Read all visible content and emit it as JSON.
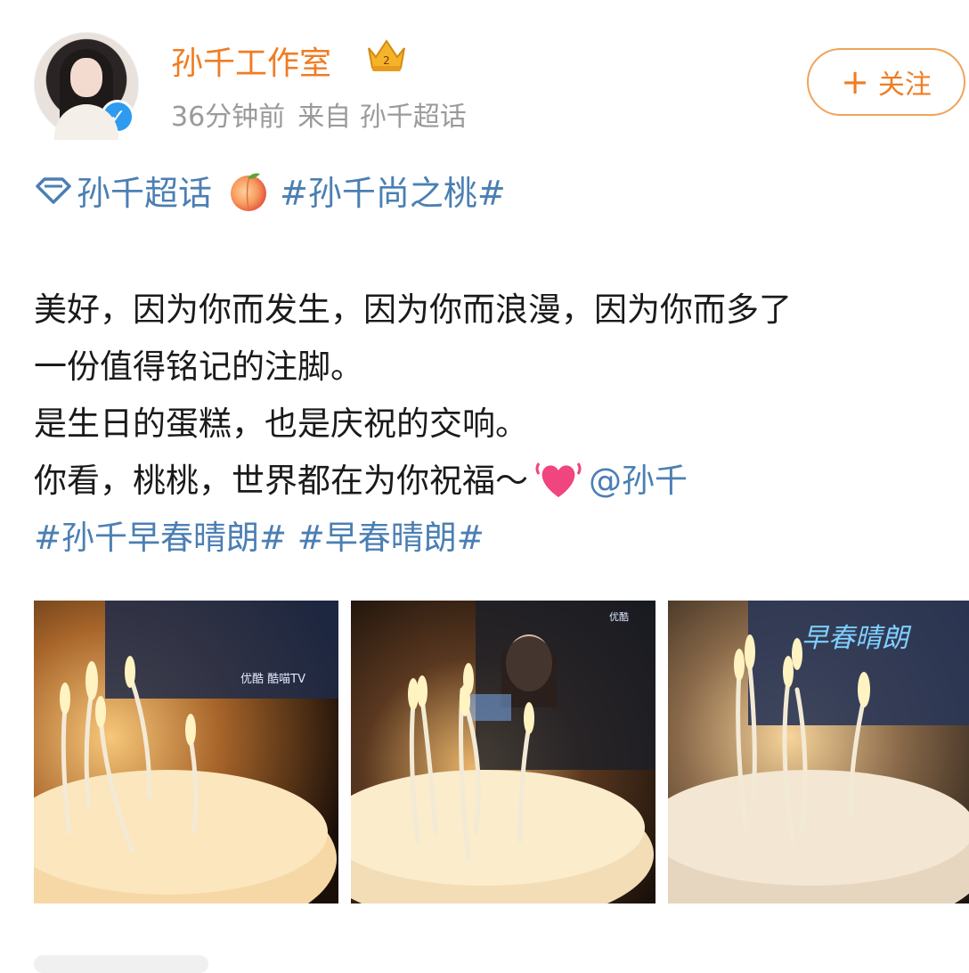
{
  "post": {
    "author_name": "孙千工作室",
    "time": "36分钟前",
    "source": "来自 孙千超话",
    "follow_label": "关注",
    "topic_super": "孙千超话",
    "topic_tag": "#孙千尚之桃#",
    "line1": "美好，因为你而发生，因为你而浪漫，因为你而多了",
    "line2": "一份值得铭记的注脚。",
    "line3": "是生日的蛋糕，也是庆祝的交响。",
    "line4": "你看，桃桃，世界都在为你祝福～",
    "mention": "@孙千",
    "tag1": "#孙千早春晴朗#",
    "tag2": "#早春晴朗#"
  },
  "icons": {
    "verified": "verified-badge-icon",
    "crown": "crown-icon",
    "plus": "plus-icon",
    "super_topic": "diamond-topic-icon",
    "peach": "peach-emoji",
    "heart": "beating-heart-emoji"
  },
  "colors": {
    "accent_orange": "#f07c23",
    "link_blue": "#4b7fb3",
    "meta_gray": "#9a9a9a",
    "verified_blue": "#2e9bf0"
  },
  "photos": [
    {
      "screen_text": "优酷 酷喵TV"
    },
    {
      "screen_text": "优酷"
    },
    {
      "screen_text": "早春晴朗"
    }
  ]
}
